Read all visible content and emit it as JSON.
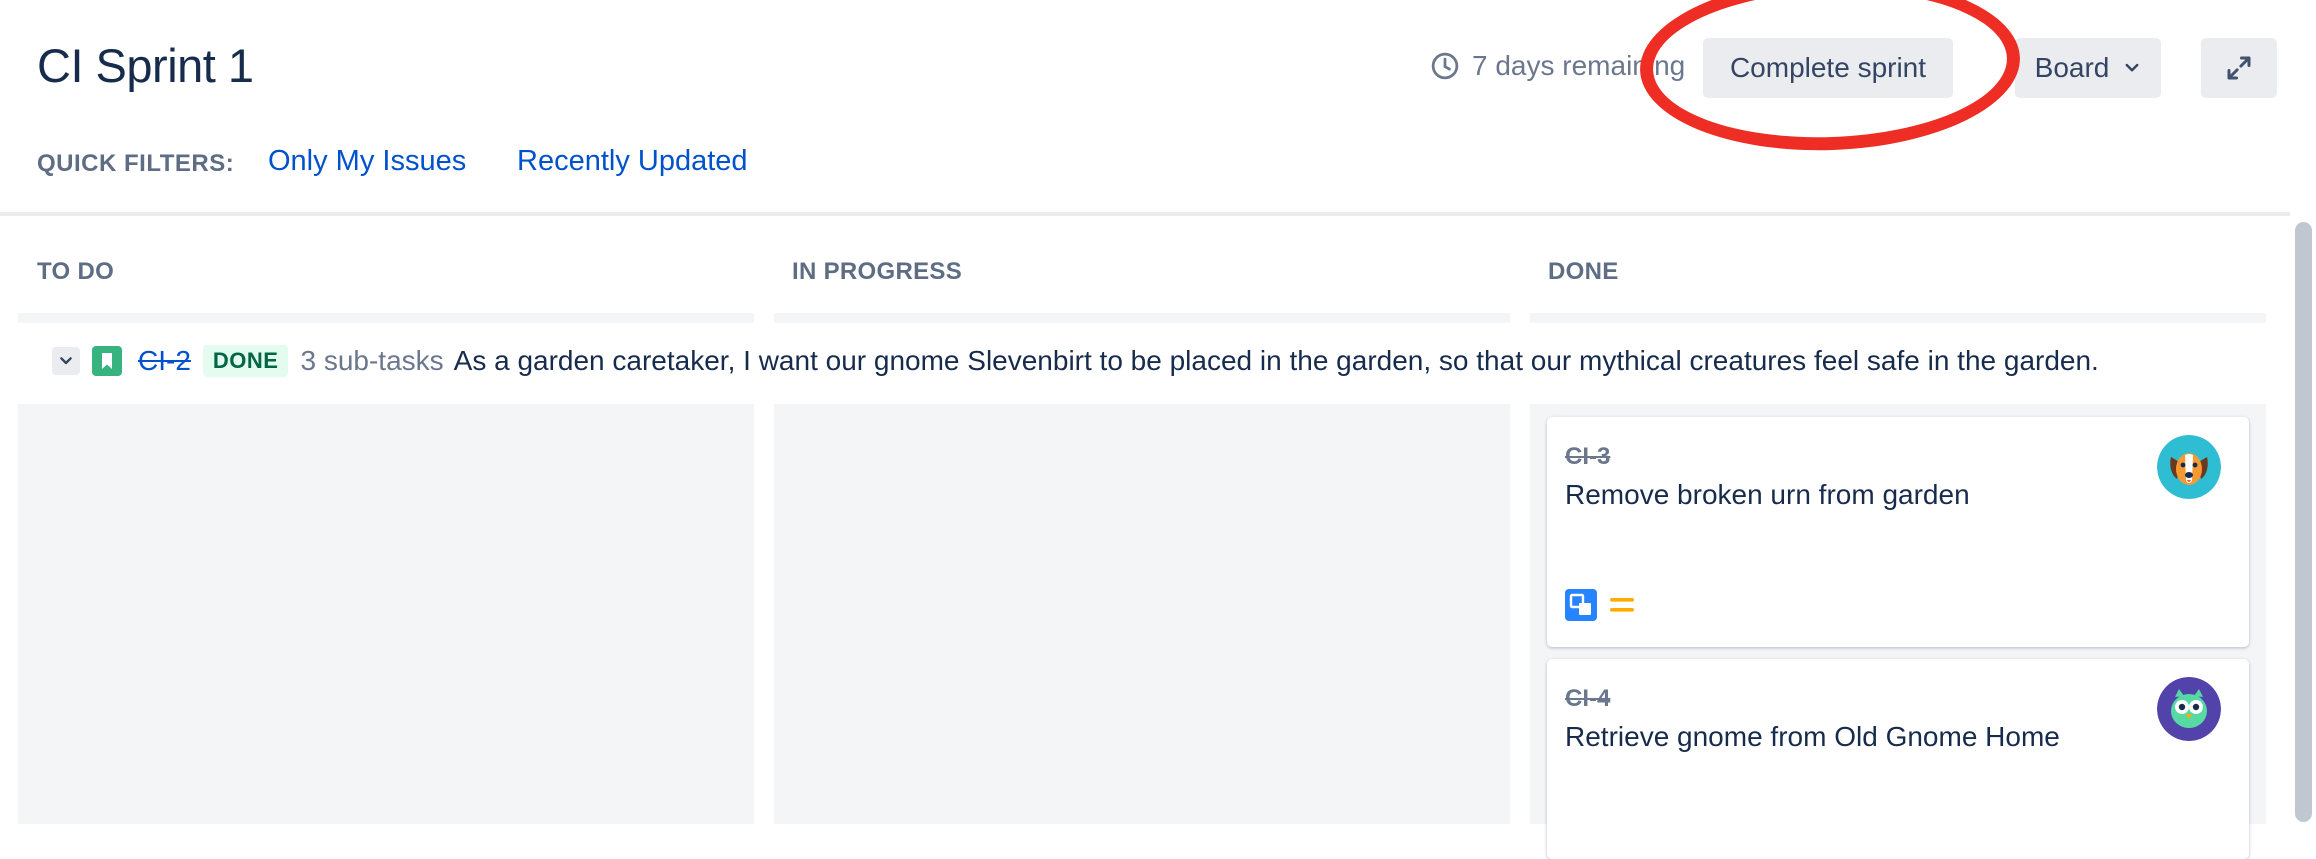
{
  "header": {
    "title": "CI Sprint 1",
    "remaining": "7 days remaining",
    "complete_button": "Complete sprint",
    "board_button": "Board"
  },
  "quick_filters": {
    "label": "QUICK FILTERS:",
    "items": [
      "Only My Issues",
      "Recently Updated"
    ]
  },
  "columns": [
    "TO DO",
    "IN PROGRESS",
    "DONE"
  ],
  "swimlane": {
    "key": "CI-2",
    "status": "DONE",
    "subtasks": "3 sub-tasks",
    "summary": "As a garden caretaker, I want our gnome Slevenbirt to be placed in the garden, so that our mythical creatures feel safe in the garden."
  },
  "cards": [
    {
      "key": "CI-3",
      "summary": "Remove broken urn from garden",
      "avatar": "dog-avatar-icon",
      "type": "subtask-icon",
      "priority": "medium-priority-icon"
    },
    {
      "key": "CI-4",
      "summary": "Retrieve gnome from Old Gnome Home",
      "avatar": "owl-avatar-icon"
    }
  ],
  "colors": {
    "accent": "#0052cc",
    "annotation": "#ee2e24",
    "done_lozenge_bg": "#e3fcef",
    "done_lozenge_text": "#006644",
    "story_green": "#36b37e",
    "priority_orange": "#ffab00"
  }
}
